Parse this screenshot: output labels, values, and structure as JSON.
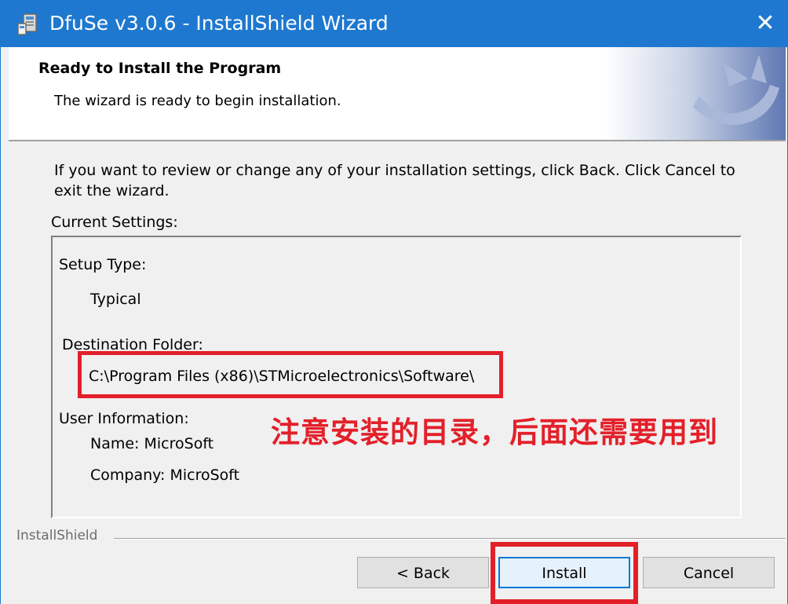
{
  "window": {
    "title": "DfuSe v3.0.6 - InstallShield Wizard",
    "close_glyph": "✕",
    "app_icon": "installer-icon"
  },
  "header": {
    "title": "Ready to Install the Program",
    "subtitle": "The wizard is ready to begin installation.",
    "art_icon": "installshield-swirl-icon"
  },
  "body": {
    "instructions": "If you want to review or change any of your installation settings, click Back. Click Cancel to exit the wizard.",
    "current_settings_label": "Current Settings:",
    "settings": {
      "setup_type_label": "Setup Type:",
      "setup_type_value": "Typical",
      "destination_label": "Destination Folder:",
      "destination_value": "C:\\Program Files (x86)\\STMicroelectronics\\Software\\",
      "user_info_label": "User Information:",
      "name_line": "Name: MicroSoft",
      "company_line": "Company: MicroSoft"
    }
  },
  "annotation": {
    "text": "注意安装的目录，后面还需要用到",
    "color": "#e3202a"
  },
  "footer": {
    "brand_label": "InstallShield"
  },
  "buttons": {
    "back": "< Back",
    "install": "Install",
    "cancel": "Cancel"
  },
  "colors": {
    "titlebar": "#1e78cf",
    "highlight": "#e3202a",
    "focus_border": "#0078d7"
  }
}
